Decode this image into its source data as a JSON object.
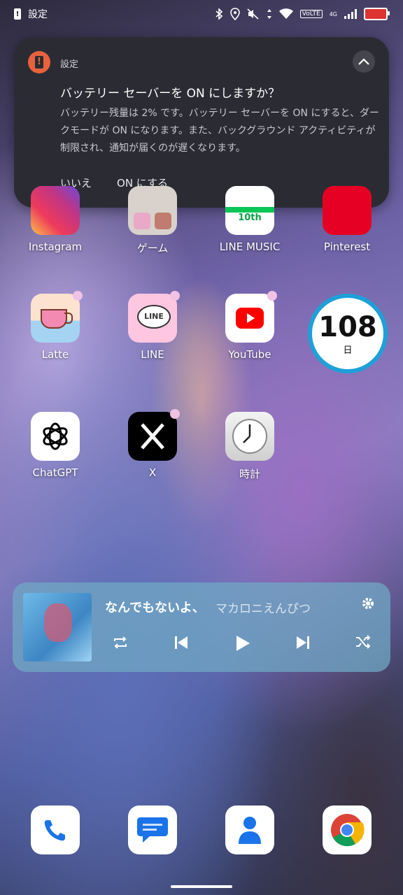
{
  "status_bar": {
    "app_label": "設定",
    "network_badge": "VoLTE",
    "network_type": "4G"
  },
  "notification": {
    "app_name": "設定",
    "title": "バッテリー セーバーを ON にしますか？",
    "body": "バッテリー残量は 2% です。バッテリー セーバーを ON にすると、ダークモードが ON になります。また、バックグラウンド アクティビティが制限され、通知が届くのが遅くなります。",
    "action_no": "いいえ",
    "action_yes": "ON にする",
    "accent_color": "#e8623d"
  },
  "apps_row1": [
    "Instagram",
    "ゲーム",
    "LINE MUSIC",
    "Pinterest"
  ],
  "apps_row2": [
    "Latte",
    "LINE",
    "YouTube"
  ],
  "apps_row3": [
    "ChatGPT",
    "X",
    "時計"
  ],
  "line_music_badge": "10th",
  "line_icon_text": "LINE",
  "counter_widget": {
    "value": "108",
    "unit": "日"
  },
  "music": {
    "song": "なんでもないよ、",
    "artist": "マカロニえんぴつ"
  },
  "dock": [
    "phone-icon",
    "messages-icon",
    "contacts-icon",
    "chrome-icon"
  ]
}
